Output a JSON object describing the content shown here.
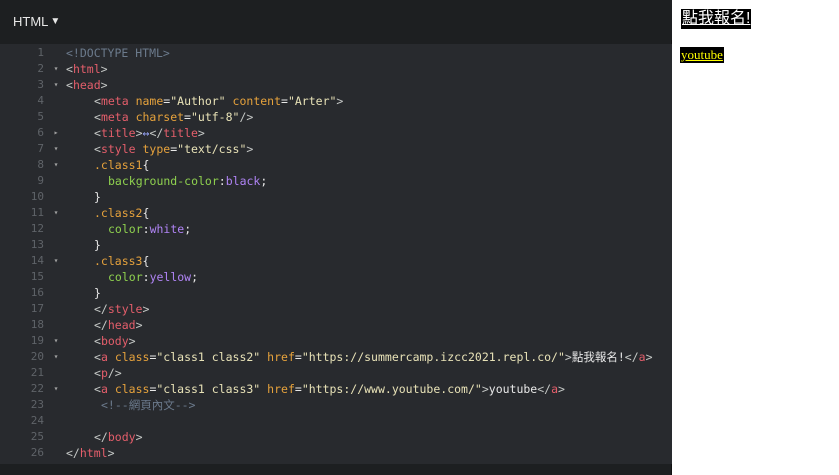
{
  "editor": {
    "language_label": "HTML",
    "lines": [
      {
        "n": "1",
        "fold": "",
        "indent": 0,
        "tokens": [
          {
            "c": "t-doc",
            "t": "<!DOCTYPE HTML>"
          }
        ]
      },
      {
        "n": "2",
        "fold": "▾",
        "indent": 0,
        "tokens": [
          {
            "c": "t-br",
            "t": "<"
          },
          {
            "c": "t-tag",
            "t": "html"
          },
          {
            "c": "t-br",
            "t": ">"
          }
        ]
      },
      {
        "n": "3",
        "fold": "▾",
        "indent": 0,
        "tokens": [
          {
            "c": "t-br",
            "t": "<"
          },
          {
            "c": "t-tag",
            "t": "head"
          },
          {
            "c": "t-br",
            "t": ">"
          }
        ]
      },
      {
        "n": "4",
        "fold": "",
        "indent": 4,
        "tokens": [
          {
            "c": "t-br",
            "t": "<"
          },
          {
            "c": "t-tag",
            "t": "meta"
          },
          {
            "c": "t-txt",
            "t": " "
          },
          {
            "c": "t-attr",
            "t": "name"
          },
          {
            "c": "t-txt",
            "t": "="
          },
          {
            "c": "t-str",
            "t": "\"Author\""
          },
          {
            "c": "t-txt",
            "t": " "
          },
          {
            "c": "t-attr",
            "t": "content"
          },
          {
            "c": "t-txt",
            "t": "="
          },
          {
            "c": "t-str",
            "t": "\"Arter\""
          },
          {
            "c": "t-br",
            "t": ">"
          }
        ]
      },
      {
        "n": "5",
        "fold": "",
        "indent": 4,
        "tokens": [
          {
            "c": "t-br",
            "t": "<"
          },
          {
            "c": "t-tag",
            "t": "meta"
          },
          {
            "c": "t-txt",
            "t": " "
          },
          {
            "c": "t-attr",
            "t": "charset"
          },
          {
            "c": "t-txt",
            "t": "="
          },
          {
            "c": "t-str",
            "t": "\"utf-8\""
          },
          {
            "c": "t-br",
            "t": "/>"
          }
        ]
      },
      {
        "n": "6",
        "fold": "▸",
        "indent": 4,
        "tokens": [
          {
            "c": "t-br",
            "t": "<"
          },
          {
            "c": "t-tag",
            "t": "title"
          },
          {
            "c": "t-br",
            "t": ">"
          },
          {
            "c": "t-ph",
            "t": "↔"
          },
          {
            "c": "t-br",
            "t": "</"
          },
          {
            "c": "t-tag",
            "t": "title"
          },
          {
            "c": "t-br",
            "t": ">"
          }
        ]
      },
      {
        "n": "7",
        "fold": "▾",
        "indent": 4,
        "tokens": [
          {
            "c": "t-br",
            "t": "<"
          },
          {
            "c": "t-tag",
            "t": "style"
          },
          {
            "c": "t-txt",
            "t": " "
          },
          {
            "c": "t-attr",
            "t": "type"
          },
          {
            "c": "t-txt",
            "t": "="
          },
          {
            "c": "t-str",
            "t": "\"text/css\""
          },
          {
            "c": "t-br",
            "t": ">"
          }
        ]
      },
      {
        "n": "8",
        "fold": "▾",
        "indent": 4,
        "tokens": [
          {
            "c": "t-sel",
            "t": ".class1"
          },
          {
            "c": "t-txt",
            "t": "{"
          }
        ]
      },
      {
        "n": "9",
        "fold": "",
        "indent": 6,
        "tokens": [
          {
            "c": "t-prop",
            "t": "background-color"
          },
          {
            "c": "t-txt",
            "t": ":"
          },
          {
            "c": "t-val",
            "t": "black"
          },
          {
            "c": "t-txt",
            "t": ";"
          }
        ]
      },
      {
        "n": "10",
        "fold": "",
        "indent": 4,
        "tokens": [
          {
            "c": "t-txt",
            "t": "}"
          }
        ]
      },
      {
        "n": "11",
        "fold": "▾",
        "indent": 4,
        "tokens": [
          {
            "c": "t-sel",
            "t": ".class2"
          },
          {
            "c": "t-txt",
            "t": "{"
          }
        ]
      },
      {
        "n": "12",
        "fold": "",
        "indent": 6,
        "tokens": [
          {
            "c": "t-prop",
            "t": "color"
          },
          {
            "c": "t-txt",
            "t": ":"
          },
          {
            "c": "t-val",
            "t": "white"
          },
          {
            "c": "t-txt",
            "t": ";"
          }
        ]
      },
      {
        "n": "13",
        "fold": "",
        "indent": 4,
        "tokens": [
          {
            "c": "t-txt",
            "t": "}"
          }
        ]
      },
      {
        "n": "14",
        "fold": "▾",
        "indent": 4,
        "tokens": [
          {
            "c": "t-sel",
            "t": ".class3"
          },
          {
            "c": "t-txt",
            "t": "{"
          }
        ]
      },
      {
        "n": "15",
        "fold": "",
        "indent": 6,
        "tokens": [
          {
            "c": "t-prop",
            "t": "color"
          },
          {
            "c": "t-txt",
            "t": ":"
          },
          {
            "c": "t-val",
            "t": "yellow"
          },
          {
            "c": "t-txt",
            "t": ";"
          }
        ]
      },
      {
        "n": "16",
        "fold": "",
        "indent": 4,
        "tokens": [
          {
            "c": "t-txt",
            "t": "}"
          }
        ]
      },
      {
        "n": "17",
        "fold": "",
        "indent": 4,
        "tokens": [
          {
            "c": "t-br",
            "t": "</"
          },
          {
            "c": "t-tag",
            "t": "style"
          },
          {
            "c": "t-br",
            "t": ">"
          }
        ]
      },
      {
        "n": "18",
        "fold": "",
        "indent": 4,
        "tokens": [
          {
            "c": "t-br",
            "t": "</"
          },
          {
            "c": "t-tag",
            "t": "head"
          },
          {
            "c": "t-br",
            "t": ">"
          }
        ]
      },
      {
        "n": "19",
        "fold": "▾",
        "indent": 4,
        "tokens": [
          {
            "c": "t-br",
            "t": "<"
          },
          {
            "c": "t-tag",
            "t": "body"
          },
          {
            "c": "t-br",
            "t": ">"
          }
        ]
      },
      {
        "n": "20",
        "fold": "▾",
        "indent": 4,
        "tokens": [
          {
            "c": "t-br",
            "t": "<"
          },
          {
            "c": "t-tag",
            "t": "a"
          },
          {
            "c": "t-txt",
            "t": " "
          },
          {
            "c": "t-attr",
            "t": "class"
          },
          {
            "c": "t-txt",
            "t": "="
          },
          {
            "c": "t-str",
            "t": "\"class1 class2\""
          },
          {
            "c": "t-txt",
            "t": " "
          },
          {
            "c": "t-attr",
            "t": "href"
          },
          {
            "c": "t-txt",
            "t": "="
          },
          {
            "c": "t-str",
            "t": "\"https://summercamp.izcc2021.repl.co/\""
          },
          {
            "c": "t-br",
            "t": ">"
          },
          {
            "c": "t-txt",
            "t": "點我報名!"
          },
          {
            "c": "t-br",
            "t": "</"
          },
          {
            "c": "t-tag",
            "t": "a"
          },
          {
            "c": "t-br",
            "t": ">"
          }
        ]
      },
      {
        "n": "21",
        "fold": "",
        "indent": 4,
        "tokens": [
          {
            "c": "t-br",
            "t": "<"
          },
          {
            "c": "t-tag",
            "t": "p"
          },
          {
            "c": "t-br",
            "t": "/>"
          }
        ]
      },
      {
        "n": "22",
        "fold": "▾",
        "indent": 4,
        "tokens": [
          {
            "c": "t-br",
            "t": "<"
          },
          {
            "c": "t-tag",
            "t": "a"
          },
          {
            "c": "t-txt",
            "t": " "
          },
          {
            "c": "t-attr",
            "t": "class"
          },
          {
            "c": "t-txt",
            "t": "="
          },
          {
            "c": "t-str",
            "t": "\"class1 class3\""
          },
          {
            "c": "t-txt",
            "t": " "
          },
          {
            "c": "t-attr",
            "t": "href"
          },
          {
            "c": "t-txt",
            "t": "="
          },
          {
            "c": "t-str",
            "t": "\"https://www.youtube.com/\""
          },
          {
            "c": "t-br",
            "t": ">"
          },
          {
            "c": "t-txt",
            "t": "youtube"
          },
          {
            "c": "t-br",
            "t": "</"
          },
          {
            "c": "t-tag",
            "t": "a"
          },
          {
            "c": "t-br",
            "t": ">"
          }
        ]
      },
      {
        "n": "23",
        "fold": "",
        "indent": 5,
        "tokens": [
          {
            "c": "t-com",
            "t": "<!--網頁內文-->"
          }
        ]
      },
      {
        "n": "24",
        "fold": "",
        "indent": 0,
        "tokens": []
      },
      {
        "n": "25",
        "fold": "",
        "indent": 4,
        "tokens": [
          {
            "c": "t-br",
            "t": "</"
          },
          {
            "c": "t-tag",
            "t": "body"
          },
          {
            "c": "t-br",
            "t": ">"
          }
        ]
      },
      {
        "n": "26",
        "fold": "",
        "indent": 0,
        "tokens": [
          {
            "c": "t-br",
            "t": "</"
          },
          {
            "c": "t-tag",
            "t": "html"
          },
          {
            "c": "t-br",
            "t": ">"
          }
        ]
      }
    ]
  },
  "preview": {
    "signup_link": "點我報名!",
    "youtube_link": "youtube"
  }
}
